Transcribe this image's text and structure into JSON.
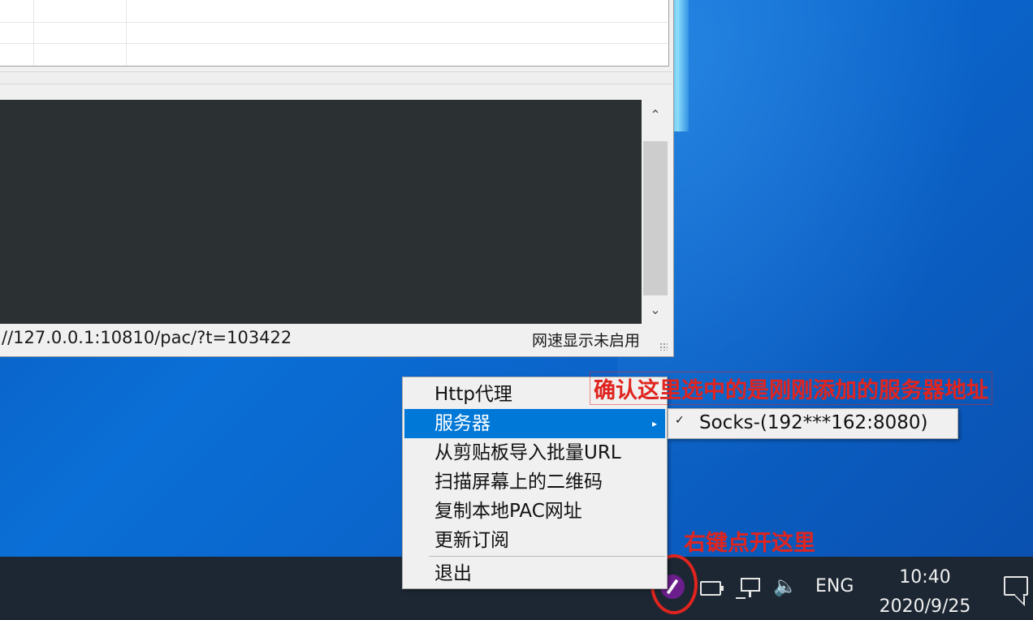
{
  "app_window": {
    "status_url": "//127.0.0.1:10810/pac/?t=103422",
    "status_speed": "网速显示未启用"
  },
  "context_menu": {
    "items": [
      {
        "label": "Http代理"
      },
      {
        "label": "服务器",
        "has_submenu": true
      },
      {
        "label": "从剪贴板导入批量URL"
      },
      {
        "label": "扫描屏幕上的二维码"
      },
      {
        "label": "复制本地PAC网址"
      },
      {
        "label": "更新订阅"
      },
      {
        "label": "退出"
      }
    ],
    "submenu": {
      "checked_server": "Socks-(192***162:8080)"
    }
  },
  "annotations": {
    "server_note": "确认这里选中的是刚刚添加的服务器地址",
    "rightclick_note": "右键点开这里"
  },
  "taskbar": {
    "language": "ENG",
    "time": "10:40",
    "date": "2020/9/25"
  },
  "colors": {
    "highlight": "#0078d7",
    "annotation_red": "#e0241f",
    "taskbar_bg": "#1d2733"
  }
}
